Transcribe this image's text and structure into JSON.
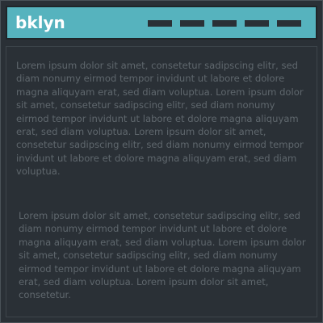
{
  "header": {
    "brand": "bklyn",
    "nav_items": [
      "",
      "",
      "",
      "",
      ""
    ],
    "background_color": "#56b3be"
  },
  "content": {
    "paragraphs": [
      "Lorem ipsum dolor sit amet, consetetur sadipscing elitr, sed diam nonumy eirmod tempor invidunt ut labore et dolore magna aliquyam erat, sed diam voluptua. Lorem ipsum dolor sit amet, consetetur sadipscing elitr, sed diam nonumy eirmod tempor invidunt ut labore et dolore magna aliquyam erat, sed diam voluptua. Lorem ipsum dolor sit amet, consetetur sadipscing elitr, sed diam nonumy eirmod tempor invidunt ut labore et dolore magna aliquyam erat, sed diam voluptua.",
      "Lorem ipsum dolor sit amet, consetetur sadipscing elitr, sed diam nonumy eirmod tempor invidunt ut labore et dolore magna aliquyam erat, sed diam voluptua. Lorem ipsum dolor sit amet, consetetur sadipscing elitr, sed diam nonumy eirmod tempor invidunt ut labore et dolore magna aliquyam erat, sed diam voluptua. Lorem ipsum dolor sit amet, consetetur."
    ]
  },
  "colors": {
    "page_background": "#2a3036",
    "text": "#5f676d",
    "nav_item": "#2a3036"
  }
}
